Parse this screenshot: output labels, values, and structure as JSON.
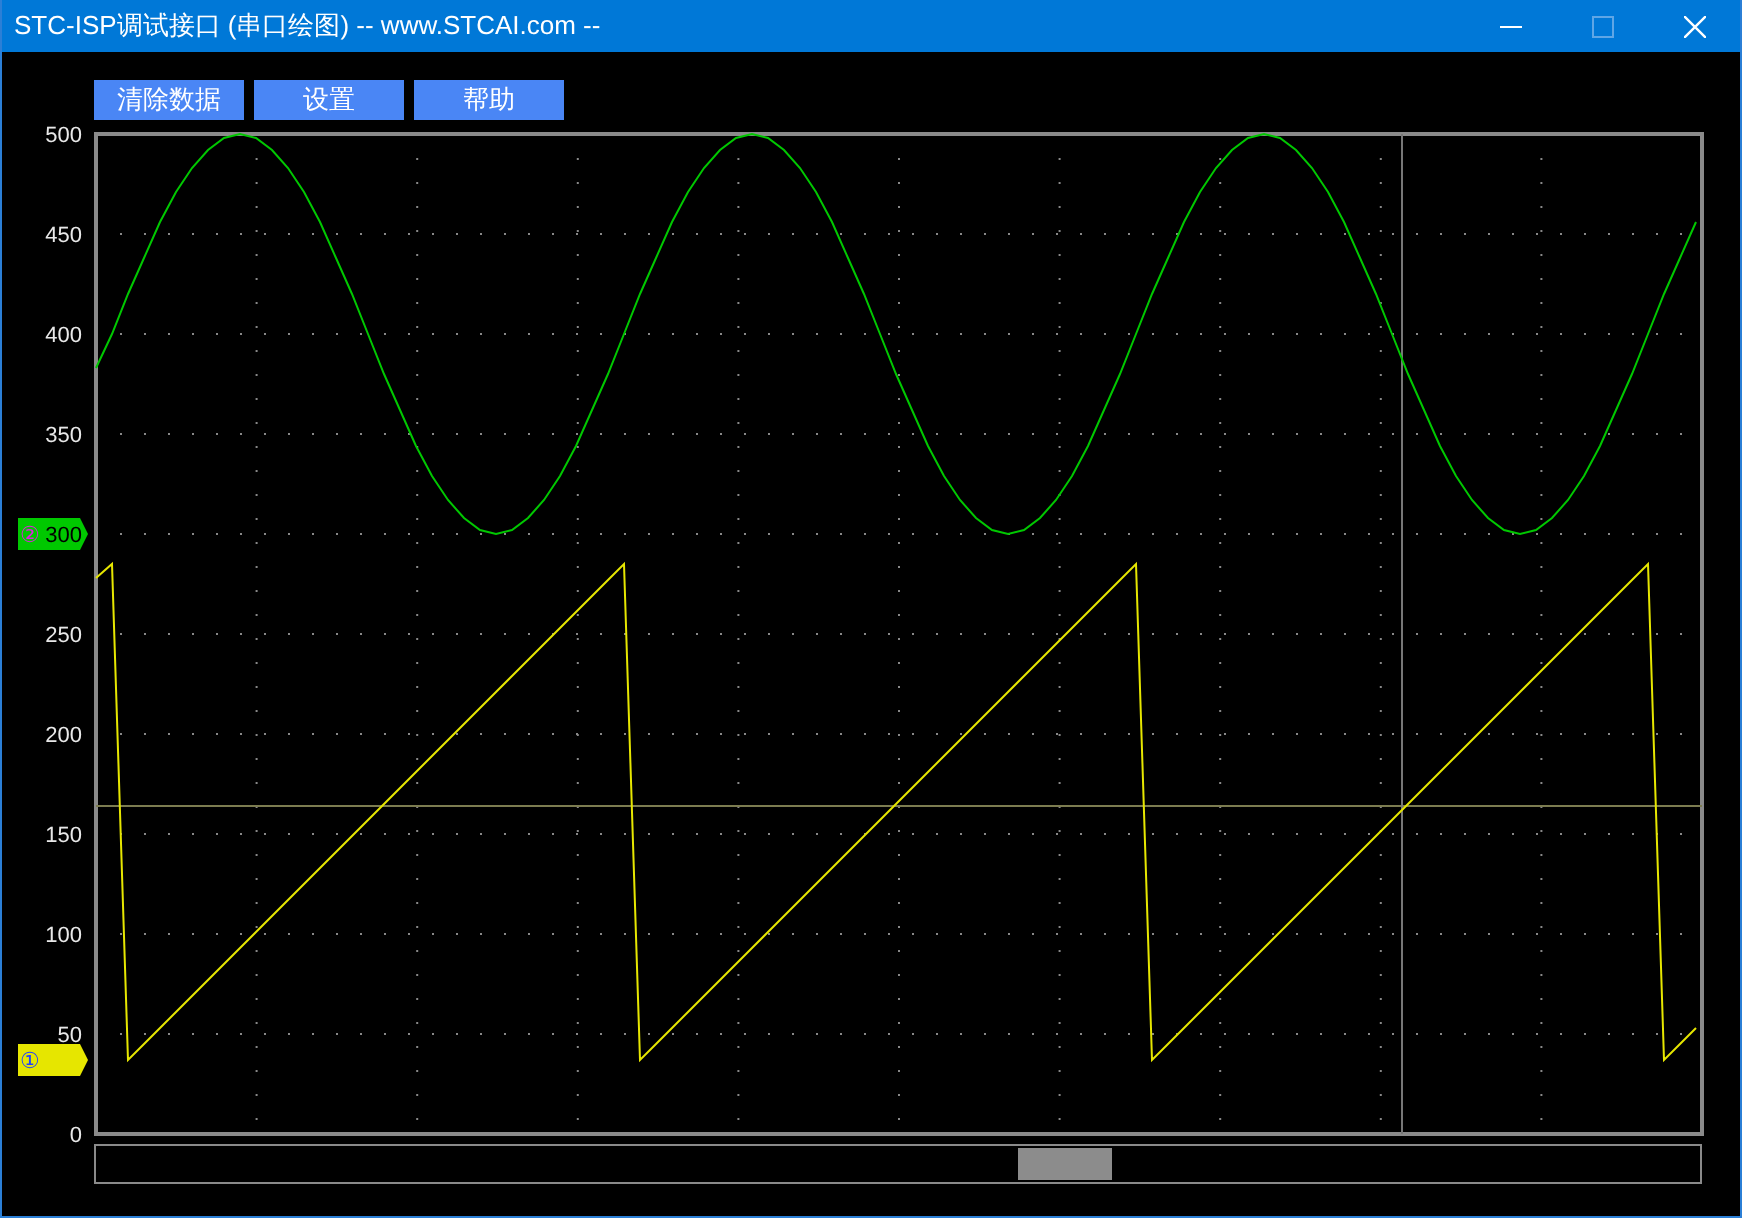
{
  "window": {
    "title": "STC-ISP调试接口 (串口绘图) -- www.STCAI.com --"
  },
  "toolbar": {
    "buttons": [
      "清除数据",
      "设置",
      "帮助"
    ]
  },
  "plot": {
    "chart_data": {
      "type": "line",
      "ylim": [
        0,
        500
      ],
      "yticks": [
        0,
        50,
        100,
        150,
        200,
        250,
        300,
        350,
        400,
        450,
        500
      ],
      "grid": true,
      "ref_lines": [
        {
          "axis": "y",
          "value": 164
        }
      ],
      "categories": [
        null,
        null,
        null,
        null,
        null,
        null,
        null,
        null,
        null,
        null,
        null,
        null,
        null,
        null,
        null,
        null,
        null,
        null,
        null,
        null,
        null,
        null,
        null,
        null,
        null,
        null,
        null,
        null,
        null,
        null,
        null,
        null,
        null,
        null,
        null,
        null,
        null,
        null,
        null,
        null,
        null,
        null,
        null,
        null,
        null,
        null,
        null,
        null,
        null,
        null,
        null,
        null,
        null,
        null,
        null,
        null,
        null,
        null,
        null,
        null,
        null,
        null,
        null,
        null,
        null,
        null,
        null,
        null,
        null,
        null,
        null,
        null,
        null,
        null,
        null,
        null,
        null,
        null,
        null,
        null,
        null,
        null,
        null,
        null,
        null,
        null,
        null,
        null,
        null,
        null,
        null,
        null,
        null,
        null,
        null,
        null,
        null,
        null,
        null,
        null,
        null
      ],
      "series": [
        {
          "name": "②",
          "color": "#00c800",
          "values": [
            383,
            400,
            420,
            438,
            456,
            471,
            483,
            492,
            498,
            500,
            498,
            492,
            483,
            471,
            456,
            438,
            420,
            400,
            380,
            362,
            344,
            329,
            317,
            308,
            302,
            300,
            302,
            308,
            317,
            329,
            344,
            362,
            380,
            400,
            420,
            438,
            456,
            471,
            483,
            492,
            498,
            500,
            498,
            492,
            483,
            471,
            456,
            438,
            420,
            400,
            380,
            362,
            344,
            329,
            317,
            308,
            302,
            300,
            302,
            308,
            317,
            329,
            344,
            362,
            380,
            400,
            420,
            438,
            456,
            471,
            483,
            492,
            498,
            500,
            498,
            492,
            483,
            471,
            456,
            438,
            420,
            400,
            380,
            362,
            344,
            329,
            317,
            308,
            302,
            300,
            302,
            308,
            317,
            329,
            344,
            362,
            380,
            400,
            420,
            438,
            456
          ]
        },
        {
          "name": "①",
          "color": "#e6e600",
          "values": [
            278,
            285,
            37,
            45,
            53,
            61,
            69,
            77,
            85,
            93,
            101,
            109,
            117,
            125,
            133,
            141,
            149,
            157,
            165,
            173,
            181,
            189,
            197,
            205,
            213,
            221,
            229,
            237,
            245,
            253,
            261,
            269,
            277,
            285,
            37,
            45,
            53,
            61,
            69,
            77,
            85,
            93,
            101,
            109,
            117,
            125,
            133,
            141,
            149,
            157,
            165,
            173,
            181,
            189,
            197,
            205,
            213,
            221,
            229,
            237,
            245,
            253,
            261,
            269,
            277,
            285,
            37,
            45,
            53,
            61,
            69,
            77,
            85,
            93,
            101,
            109,
            117,
            125,
            133,
            141,
            149,
            157,
            165,
            173,
            181,
            189,
            197,
            205,
            213,
            221,
            229,
            237,
            245,
            253,
            261,
            269,
            277,
            285,
            37,
            45,
            53
          ]
        }
      ]
    }
  }
}
